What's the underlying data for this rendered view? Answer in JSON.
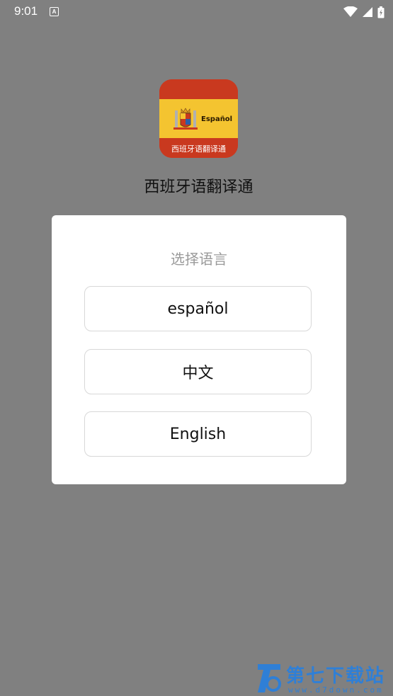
{
  "status_bar": {
    "time": "9:01",
    "notification_glyph": "A",
    "icons": [
      "wifi-icon",
      "signal-icon",
      "battery-charging-icon"
    ]
  },
  "app": {
    "icon_word": "Español",
    "icon_subtitle": "西班牙语翻译通",
    "name": "西班牙语翻译通"
  },
  "dialog": {
    "title": "选择语言",
    "options": [
      {
        "label": "español"
      },
      {
        "label": "中文"
      },
      {
        "label": "English"
      }
    ]
  },
  "watermark": {
    "text": "第七下载站",
    "url": "www.d7down.com"
  },
  "colors": {
    "overlay": "#808080",
    "dialog_bg": "#ffffff",
    "title_gray": "#9a9a9a",
    "button_border": "#d8d8d8",
    "flag_red": "#c9391f",
    "flag_yellow": "#f4c430",
    "watermark_blue": "#2f7fd6"
  }
}
